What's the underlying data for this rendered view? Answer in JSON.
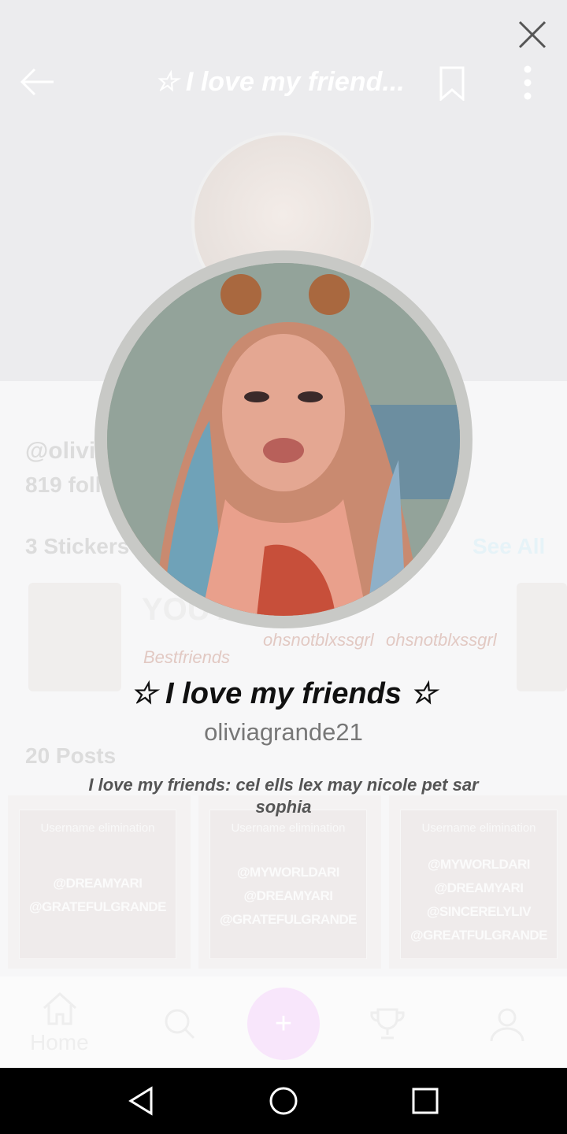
{
  "header": {
    "title": "☆ I love my friend...",
    "back_icon": "arrow-left-icon",
    "bookmark_icon": "bookmark-icon",
    "more_icon": "more-vertical-icon",
    "close_icon": "close-icon"
  },
  "background": {
    "handle": "@olivia",
    "followers": "819 foll",
    "stickers_label": "3 Stickers",
    "see_all": "See All",
    "posts_label": "20 Posts",
    "sticker_text_1": "YOU AND",
    "sticker_text_2": "Bestfriends",
    "sticker_text_3": "ohsnotblxssgrl",
    "sticker_text_4": "ohsnotblxssgrl",
    "posts": [
      {
        "title": "Username elimination",
        "tags": [
          "@DREAMYARI",
          "@GRATEFULGRANDE"
        ]
      },
      {
        "title": "Username elimination",
        "tags": [
          "@MYWORLDARI",
          "@DREAMYARI",
          "@GRATEFULGRANDE"
        ]
      },
      {
        "title": "Username elimination",
        "tags": [
          "@MYWORLDARI",
          "@DREAMYARI",
          "@SINCERELYLIV",
          "@GREATFULGRANDE"
        ]
      }
    ],
    "nav_home_label": "Home",
    "nav_fab": "+"
  },
  "chat": {
    "title": "☆ I love my friends ☆",
    "host": "oliviagrande21",
    "desc_name": "I love my friends",
    "desc_text": ": cel ells lex may nicole pet sar sophia"
  },
  "colors": {
    "header_title": "#ffffff",
    "title_text": "#111111",
    "host_text": "#777777",
    "fab": "#f8e6fb"
  }
}
